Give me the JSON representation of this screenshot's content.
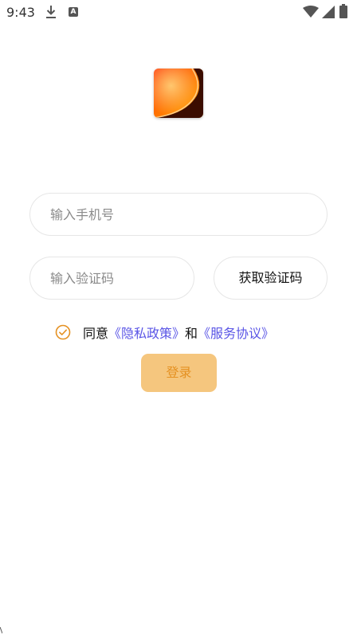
{
  "status_bar": {
    "time": "9:43",
    "icons": [
      "download-icon",
      "a-icon",
      "wifi-icon",
      "signal-icon",
      "battery-icon"
    ],
    "a_glyph": "A"
  },
  "logo": {
    "name": "app-logo",
    "colors": [
      "#ff3b12",
      "#ff8a00",
      "#3b0d00"
    ]
  },
  "form": {
    "phone_placeholder": "输入手机号",
    "code_placeholder": "输入验证码",
    "get_code_label": "获取验证码"
  },
  "agreement": {
    "checked": true,
    "prefix": "同意",
    "privacy_link": "《隐私政策》",
    "conjunction": "和",
    "service_link": "《服务协议》"
  },
  "login": {
    "label": "登录"
  },
  "colors": {
    "accent": "#e59122",
    "button_bg": "#f5c67e",
    "link": "#5a55e6",
    "border": "#e6e6e6"
  }
}
